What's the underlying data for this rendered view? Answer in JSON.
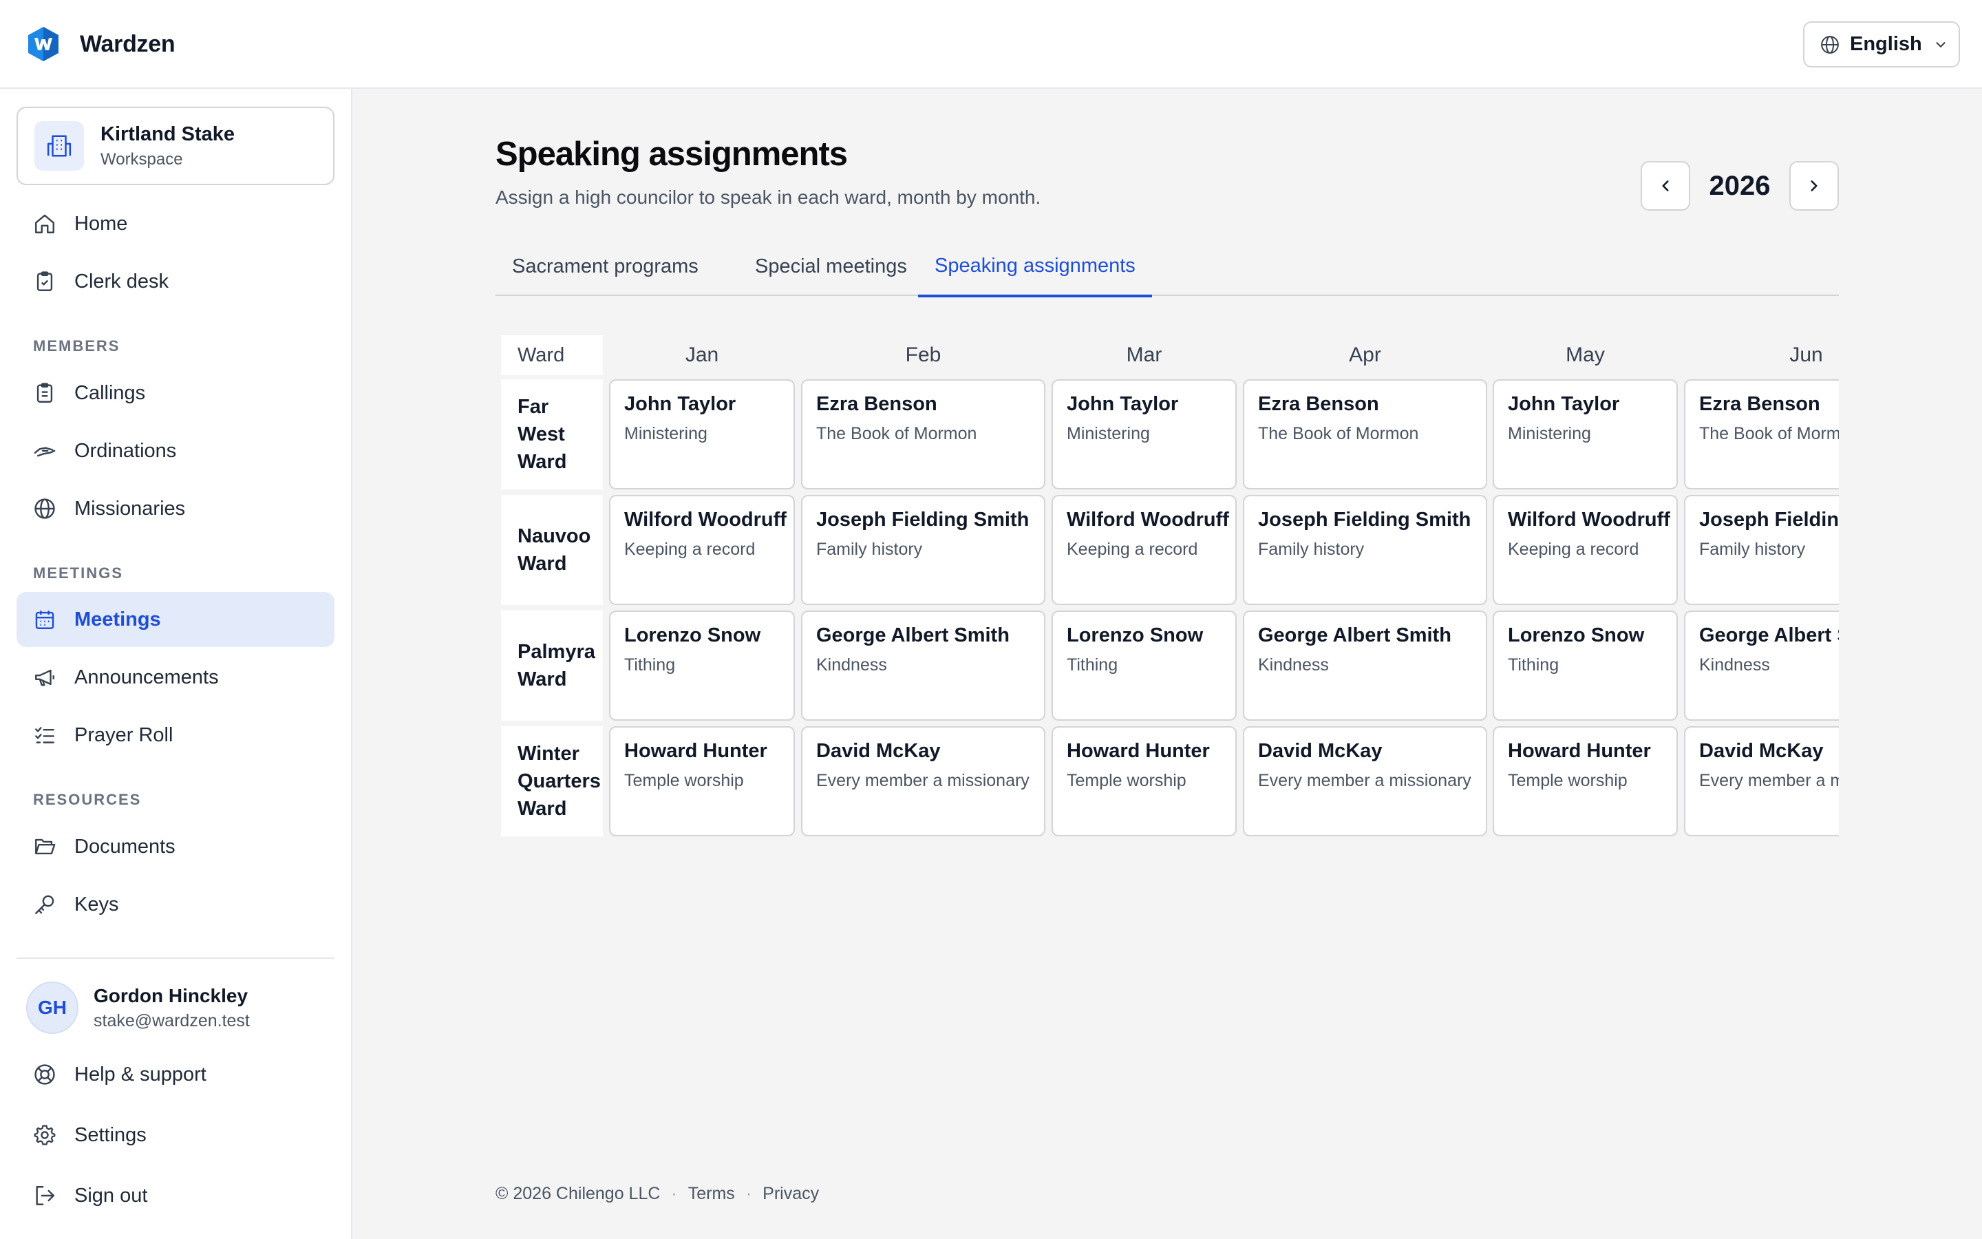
{
  "app": {
    "name": "Wardzen"
  },
  "language": {
    "label": "English"
  },
  "workspace": {
    "name": "Kirtland Stake",
    "type": "Workspace"
  },
  "nav": {
    "home": "Home",
    "clerk_desk": "Clerk desk",
    "members_section": "MEMBERS",
    "callings": "Callings",
    "ordinations": "Ordinations",
    "missionaries": "Missionaries",
    "meetings_section": "MEETINGS",
    "meetings": "Meetings",
    "announcements": "Announcements",
    "prayer_roll": "Prayer Roll",
    "resources_section": "RESOURCES",
    "documents": "Documents",
    "keys": "Keys",
    "help": "Help & support",
    "settings": "Settings",
    "sign_out": "Sign out"
  },
  "user": {
    "initials": "GH",
    "name": "Gordon Hinckley",
    "email": "stake@wardzen.test"
  },
  "page": {
    "title": "Speaking assignments",
    "subtitle": "Assign a high councilor to speak in each ward, month by month.",
    "year": "2026"
  },
  "tabs": [
    "Sacrament programs",
    "Special meetings",
    "Speaking assignments"
  ],
  "grid": {
    "ward_header": "Ward",
    "months": [
      "Jan",
      "Feb",
      "Mar",
      "Apr",
      "May",
      "Jun"
    ],
    "rows": [
      {
        "ward": "Far West Ward",
        "cells": [
          {
            "name": "John Taylor",
            "topic": "Ministering"
          },
          {
            "name": "Ezra Benson",
            "topic": "The Book of Mormon"
          },
          {
            "name": "John Taylor",
            "topic": "Ministering"
          },
          {
            "name": "Ezra Benson",
            "topic": "The Book of Mormon"
          },
          {
            "name": "John Taylor",
            "topic": "Ministering"
          },
          {
            "name": "Ezra Benson",
            "topic": "The Book of Mormon"
          }
        ]
      },
      {
        "ward": "Nauvoo Ward",
        "cells": [
          {
            "name": "Wilford Woodruff",
            "topic": "Keeping a record"
          },
          {
            "name": "Joseph Fielding Smith",
            "topic": "Family history"
          },
          {
            "name": "Wilford Woodruff",
            "topic": "Keeping a record"
          },
          {
            "name": "Joseph Fielding Smith",
            "topic": "Family history"
          },
          {
            "name": "Wilford Woodruff",
            "topic": "Keeping a record"
          },
          {
            "name": "Joseph Fielding Smith",
            "topic": "Family history"
          }
        ]
      },
      {
        "ward": "Palmyra Ward",
        "cells": [
          {
            "name": "Lorenzo Snow",
            "topic": "Tithing"
          },
          {
            "name": "George Albert Smith",
            "topic": "Kindness"
          },
          {
            "name": "Lorenzo Snow",
            "topic": "Tithing"
          },
          {
            "name": "George Albert Smith",
            "topic": "Kindness"
          },
          {
            "name": "Lorenzo Snow",
            "topic": "Tithing"
          },
          {
            "name": "George Albert Smith",
            "topic": "Kindness"
          }
        ]
      },
      {
        "ward": "Winter Quarters Ward",
        "cells": [
          {
            "name": "Howard Hunter",
            "topic": "Temple worship"
          },
          {
            "name": "David McKay",
            "topic": "Every member a missionary"
          },
          {
            "name": "Howard Hunter",
            "topic": "Temple worship"
          },
          {
            "name": "David McKay",
            "topic": "Every member a missionary"
          },
          {
            "name": "Howard Hunter",
            "topic": "Temple worship"
          },
          {
            "name": "David McKay",
            "topic": "Every member a missionary"
          }
        ]
      }
    ]
  },
  "footer": {
    "copyright": "© 2026 Chilengo LLC",
    "terms": "Terms",
    "privacy": "Privacy"
  },
  "colors": {
    "accent": "#1d4ed8",
    "accent_bg": "#e3eaf9",
    "background": "#f4f4f5",
    "border": "#d4d4d8"
  }
}
